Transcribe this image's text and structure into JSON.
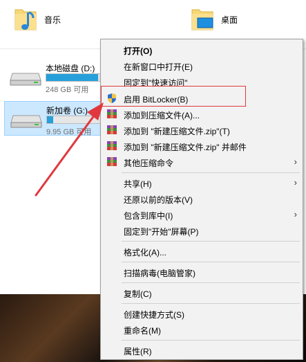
{
  "folders": [
    {
      "name": "音乐",
      "icon": "music-folder-icon"
    },
    {
      "name": "桌面",
      "icon": "desktop-folder-icon"
    }
  ],
  "drives": [
    {
      "name": "本地磁盘 (D:)",
      "size_text": "248 GB 可用",
      "used_fraction": 0.85,
      "selected": false
    },
    {
      "name": "新加卷 (G:)",
      "size_text": "9.95 GB 可用",
      "used_fraction": 0.1,
      "selected": true
    }
  ],
  "context_menu": {
    "open": "打开(O)",
    "open_new_window": "在新窗口中打开(E)",
    "pin_quick_access": "固定到\"快速访问\"",
    "bitlocker": "启用 BitLocker(B)",
    "add_archive": "添加到压缩文件(A)...",
    "add_zip": "添加到 \"新建压缩文件.zip\"(T)",
    "add_zip_mail": "添加到 \"新建压缩文件.zip\" 并邮件",
    "other_compress": "其他压缩命令",
    "share": "共享(H)",
    "restore_versions": "还原以前的版本(V)",
    "include_library": "包含到库中(I)",
    "pin_start": "固定到\"开始\"屏幕(P)",
    "format": "格式化(A)...",
    "scan_virus": "扫描病毒(电脑管家)",
    "copy": "复制(C)",
    "create_shortcut": "创建快捷方式(S)",
    "rename": "重命名(M)",
    "properties": "属性(R)"
  },
  "colors": {
    "highlight_box": "#e0383e",
    "arrow": "#e0383e",
    "drive_bar": "#26a0da"
  }
}
